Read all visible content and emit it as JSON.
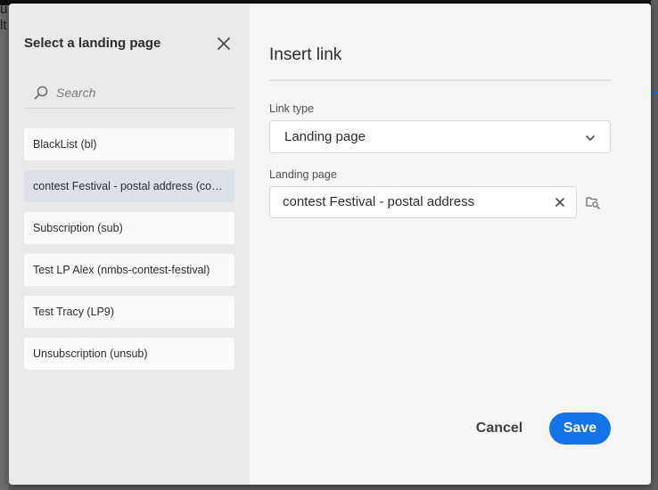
{
  "background": {
    "text_line1": "u",
    "text_line2": "lt"
  },
  "left_panel": {
    "title": "Select a landing page",
    "close_icon": "close-icon",
    "search": {
      "placeholder": "Search",
      "icon": "search-icon"
    },
    "items": [
      {
        "label": "BlackList (bl)",
        "selected": false
      },
      {
        "label": "contest Festival - postal address (contest-festival-postal-address)",
        "selected": true
      },
      {
        "label": "Subscription (sub)",
        "selected": false
      },
      {
        "label": "Test LP Alex (nmbs-contest-festival)",
        "selected": false
      },
      {
        "label": "Test Tracy (LP9)",
        "selected": false
      },
      {
        "label": "Unsubscription (unsub)",
        "selected": false
      }
    ]
  },
  "right_panel": {
    "title": "Insert link",
    "link_type": {
      "label": "Link type",
      "value": "Landing page",
      "icon": "chevron-down-icon"
    },
    "landing_page": {
      "label": "Landing page",
      "value": "contest Festival - postal address",
      "clear_icon": "clear-icon",
      "browse_icon": "folder-search-icon"
    },
    "cancel_label": "Cancel",
    "save_label": "Save"
  },
  "colors": {
    "accent": "#1473e6",
    "selected_item": "#dbe0e9",
    "left_panel_bg": "#e9e9e9",
    "right_panel_bg": "#f5f5f5"
  }
}
